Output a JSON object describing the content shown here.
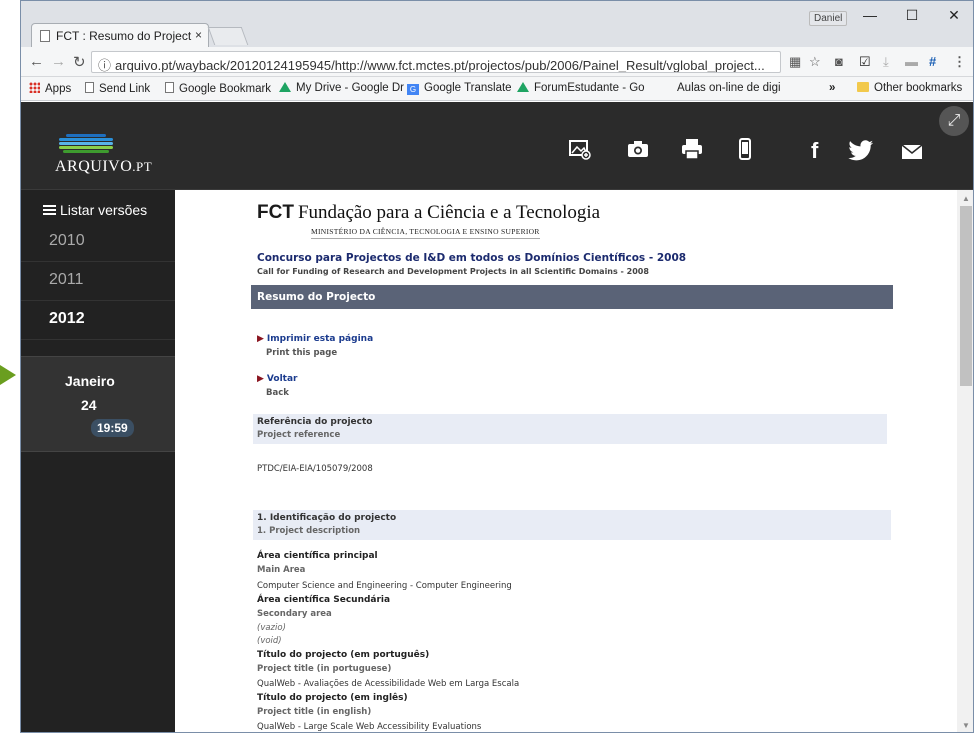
{
  "browser": {
    "tab_title": "FCT : Resumo do Project",
    "tab_close": "×",
    "user": "Daniel",
    "minimize": "—",
    "maximize": "☐",
    "close": "✕",
    "url": "arquivo.pt/wayback/20120124195945/http://www.fct.mctes.pt/projectos/pub/2006/Painel_Result/vglobal_project...",
    "bookmarks": [
      "Apps",
      "Send Link",
      "Google Bookmark",
      "My Drive - Google Dr",
      "Google Translate",
      "ForumEstudante - Go",
      "Aulas on-line de digi",
      "»",
      "Other bookmarks"
    ]
  },
  "header": {
    "logo": "ARQUIVO",
    "logo_suffix": ".PT",
    "icons": [
      "image-add-icon",
      "camera-icon",
      "print-icon",
      "mobile-icon",
      "facebook-icon",
      "twitter-icon",
      "mail-icon"
    ],
    "facebook": "f",
    "expand": "⤢"
  },
  "sidebar": {
    "title": "Listar versões",
    "years": [
      "2010",
      "2011",
      "2012"
    ],
    "month": "Janeiro",
    "day": "24",
    "time": "19:59"
  },
  "content": {
    "fct_abbr": "FCT",
    "fct_name": "Fundação para a Ciência e a Tecnologia",
    "ministry": "MINISTÉRIO DA CIÊNCIA, TECNOLOGIA E ENSINO SUPERIOR",
    "concurso": "Concurso para Projectos de I&D em todos os Domínios Científicos - 2008",
    "call": "Call for Funding of Research and Development Projects in all Scientific Domains - 2008",
    "banner": "Resumo do Projecto",
    "print_pt": "Imprimir esta página",
    "print_en": "Print this page",
    "back_pt": "Voltar",
    "back_en": "Back",
    "ref_pt": "Referência do projecto",
    "ref_en": "Project reference",
    "ref_value": "PTDC/EIA-EIA/105079/2008",
    "sec1_pt": "1. Identificação do projecto",
    "sec1_en": "1. Project description",
    "main_area_pt": "Área científica principal",
    "main_area_en": "Main Area",
    "main_area_value": "Computer Science and Engineering - Computer Engineering",
    "sec_area_pt": "Área científica Secundária",
    "sec_area_en": "Secondary area",
    "vazio": "(vazio)",
    "void": "(void)",
    "title_pt_label": "Título do projecto (em português)",
    "title_pt_en": "Project title (in portuguese)",
    "title_pt_value": "QualWeb - Avaliações de Acessibilidade Web em Larga Escala",
    "title_en_label": "Título do projecto (em inglês)",
    "title_en_en": "Project title (in english)",
    "title_en_value": "QualWeb - Large Scale Web Accessibility Evaluations"
  }
}
